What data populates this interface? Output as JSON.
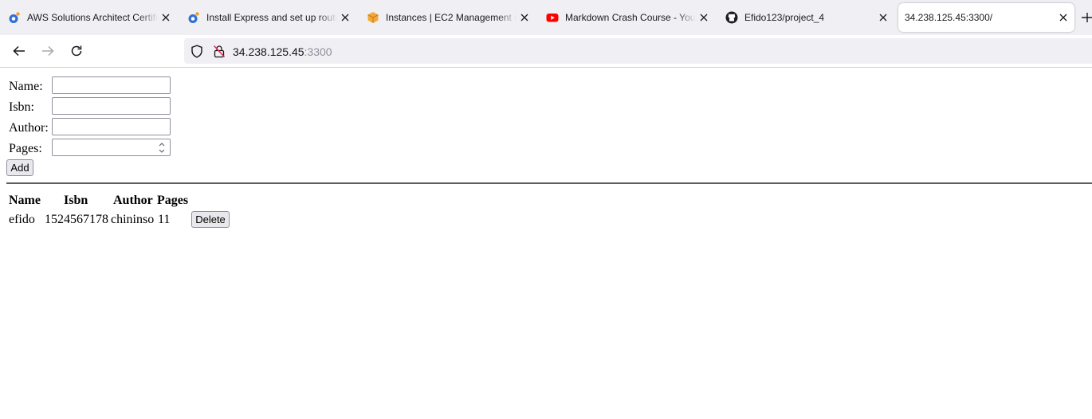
{
  "browser": {
    "tabs": [
      {
        "title": "AWS Solutions Architect Certification",
        "icon": "blue-swirl-icon",
        "active": false
      },
      {
        "title": "Install Express and set up routes",
        "icon": "blue-swirl-icon",
        "active": false
      },
      {
        "title": "Instances | EC2 Management Console",
        "icon": "aws-cube-icon",
        "active": false
      },
      {
        "title": "Markdown Crash Course - YouTube",
        "icon": "youtube-icon",
        "active": false
      },
      {
        "title": "Efido123/project_4",
        "icon": "github-icon",
        "active": false
      },
      {
        "title": "34.238.125.45:3300/",
        "icon": "",
        "active": true
      }
    ],
    "address": {
      "host": "34.238.125.45",
      "port": ":3300"
    },
    "colors": {
      "tabstrip": "#f0f0f4",
      "youtube": "#ff0000",
      "aws": "#f2a93b",
      "swirl": "#2f6fd4"
    }
  },
  "form": {
    "fields": [
      {
        "label": "Name:",
        "value": ""
      },
      {
        "label": "Isbn:",
        "value": ""
      },
      {
        "label": "Author:",
        "value": ""
      },
      {
        "label": "Pages:",
        "value": ""
      }
    ],
    "add_label": "Add"
  },
  "table": {
    "headers": [
      "Name",
      "Isbn",
      "Author",
      "Pages"
    ],
    "rows": [
      {
        "name": "efido",
        "isbn": "1524567178",
        "author": "chininso",
        "pages": "11",
        "delete_label": "Delete"
      }
    ]
  }
}
